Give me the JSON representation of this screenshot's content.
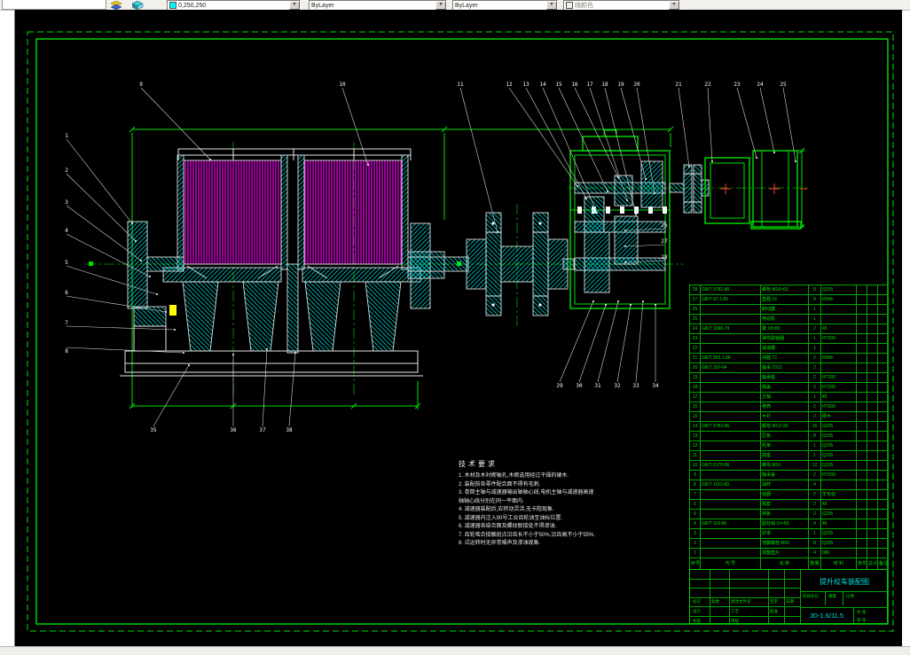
{
  "toolbar": {
    "color_value": "0,250,250",
    "linetype_value": "ByLayer",
    "lineweight_value": "ByLayer",
    "plotstyle_value": "随颜色",
    "swatch_color": "#00fafa"
  },
  "tech": {
    "heading": "技术要求",
    "lines": [
      "1. 木材及木衬楔轴孔,木楔选用经过干燥的硬木.",
      "2. 装配前各零件配合面不得有毛刺.",
      "3. 卷筒主轴与减速器输出轴轴心线,电机主轴与减速器高速",
      "   轴轴心线分别在同一平面内.",
      "4. 减速器装配后,应转动灵活,无卡阻现象.",
      "5. 减速器内注入90号工业齿轮油至油标位置.",
      "6. 减速器各结合面及螺纹联接处不得渗油.",
      "7. 齿轮啮合接触斑点沿齿长不小于50%,沿齿高不小于55%.",
      "8. 试运转时无异常噪声及渗油现象."
    ]
  },
  "bom": {
    "headers": [
      "序号",
      "代  号",
      "名  称",
      "数量",
      "材  料",
      "单件",
      "总计",
      "备注"
    ],
    "rows": [
      [
        "28",
        "GB/T 5782-86",
        "螺栓 M16×60",
        "8",
        "Q235",
        "",
        "",
        ""
      ],
      [
        "27",
        "GB/T 97.1-85",
        "垫圈 16",
        "8",
        "65Mn",
        "",
        "",
        ""
      ],
      [
        "26",
        "",
        "制动器",
        "1",
        "",
        "",
        "",
        ""
      ],
      [
        "25",
        "",
        "电动机",
        "1",
        "",
        "",
        "",
        ""
      ],
      [
        "24",
        "GB/T 1096-79",
        "键 18×80",
        "2",
        "45",
        "",
        "",
        ""
      ],
      [
        "23",
        "",
        "弹性联轴器",
        "1",
        "HT200",
        "",
        "",
        ""
      ],
      [
        "22",
        "",
        "减速器",
        "1",
        "",
        "",
        "",
        ""
      ],
      [
        "21",
        "GB/T 893.1-86",
        "挡圈 72",
        "2",
        "65Mn",
        "",
        "",
        ""
      ],
      [
        "20",
        "GB/T 297-84",
        "轴承 7312",
        "2",
        "",
        "",
        "",
        ""
      ],
      [
        "19",
        "",
        "轴承座",
        "2",
        "HT200",
        "",
        "",
        ""
      ],
      [
        "18",
        "",
        "端盖",
        "2",
        "HT200",
        "",
        "",
        ""
      ],
      [
        "17",
        "",
        "主轴",
        "1",
        "45",
        "",
        "",
        ""
      ],
      [
        "16",
        "",
        "卷筒",
        "2",
        "HT200",
        "",
        "",
        ""
      ],
      [
        "15",
        "",
        "木衬",
        "2",
        "硬木",
        "",
        "",
        ""
      ],
      [
        "14",
        "GB/T 5783-86",
        "螺栓 M12×35",
        "16",
        "Q235",
        "",
        "",
        ""
      ],
      [
        "13",
        "",
        "压板",
        "8",
        "Q235",
        "",
        "",
        ""
      ],
      [
        "12",
        "",
        "机架",
        "1",
        "Q235",
        "",
        "",
        ""
      ],
      [
        "11",
        "",
        "底座",
        "1",
        "Q235",
        "",
        "",
        ""
      ],
      [
        "10",
        "GB/T 6170-86",
        "螺母 M16",
        "12",
        "Q235",
        "",
        "",
        ""
      ],
      [
        "9",
        "",
        "轴承盖",
        "2",
        "HT200",
        "",
        "",
        ""
      ],
      [
        "8",
        "GB/T 1152-89",
        "油杯",
        "4",
        "",
        "",
        "",
        ""
      ],
      [
        "7",
        "",
        "毡圈",
        "2",
        "羊毛毡",
        "",
        "",
        ""
      ],
      [
        "6",
        "",
        "隔套",
        "2",
        "45",
        "",
        "",
        ""
      ],
      [
        "5",
        "",
        "挡板",
        "2",
        "Q235",
        "",
        "",
        ""
      ],
      [
        "4",
        "GB/T 119-86",
        "圆柱销 10×50",
        "4",
        "45",
        "",
        "",
        ""
      ],
      [
        "3",
        "",
        "护罩",
        "1",
        "Q235",
        "",
        "",
        ""
      ],
      [
        "2",
        "",
        "地脚螺栓 M20",
        "8",
        "Q235",
        "",
        "",
        ""
      ],
      [
        "1",
        "",
        "调整垫片",
        "4",
        "08F",
        "",
        "",
        ""
      ]
    ]
  },
  "titleblock": {
    "title": "提升绞车装配图",
    "code": "JD-1.6/11.5",
    "labels": {
      "mark": "标记",
      "count": "处数",
      "doc": "更改文件号",
      "sign": "签字",
      "date": "日期",
      "design": "设计",
      "check": "校核",
      "process": "工艺",
      "review": "审核",
      "approve": "批准",
      "stage": "阶段标记",
      "weight": "重量",
      "scale": "比例",
      "sheets": "共 张",
      "sheet": "第 张"
    }
  },
  "drawing": {
    "balloons": [
      [
        1,
        74,
        155,
        148,
        252
      ],
      [
        2,
        74,
        194,
        152,
        272
      ],
      [
        3,
        74,
        230,
        158,
        294
      ],
      [
        4,
        74,
        262,
        168,
        312
      ],
      [
        5,
        74,
        298,
        176,
        332
      ],
      [
        6,
        74,
        332,
        186,
        352
      ],
      [
        7,
        74,
        366,
        196,
        372
      ],
      [
        8,
        74,
        398,
        206,
        398
      ],
      [
        9,
        158,
        97,
        236,
        180
      ],
      [
        10,
        385,
        97,
        414,
        186
      ],
      [
        11,
        518,
        97,
        560,
        262
      ],
      [
        12,
        573,
        97,
        650,
        210
      ],
      [
        13,
        592,
        97,
        660,
        224
      ],
      [
        14,
        611,
        97,
        672,
        240
      ],
      [
        15,
        629,
        97,
        684,
        216
      ],
      [
        16,
        647,
        97,
        696,
        200
      ],
      [
        17,
        664,
        97,
        706,
        226
      ],
      [
        18,
        681,
        97,
        716,
        242
      ],
      [
        19,
        699,
        97,
        727,
        202
      ],
      [
        20,
        717,
        97,
        737,
        218
      ],
      [
        21,
        764,
        97,
        776,
        188
      ],
      [
        22,
        797,
        97,
        802,
        182
      ],
      [
        23,
        830,
        97,
        852,
        178
      ],
      [
        24,
        856,
        97,
        872,
        172
      ],
      [
        25,
        882,
        97,
        896,
        182
      ],
      [
        26,
        748,
        256,
        704,
        260
      ],
      [
        27,
        748,
        274,
        704,
        278
      ],
      [
        28,
        748,
        292,
        704,
        296
      ],
      [
        29,
        630,
        437,
        668,
        340
      ],
      [
        30,
        652,
        437,
        682,
        344
      ],
      [
        31,
        673,
        437,
        696,
        340
      ],
      [
        32,
        695,
        437,
        710,
        344
      ],
      [
        33,
        716,
        437,
        724,
        340
      ],
      [
        34,
        738,
        437,
        738,
        344
      ],
      [
        35,
        172,
        487,
        212,
        412
      ],
      [
        36,
        262,
        487,
        262,
        400
      ],
      [
        37,
        295,
        487,
        300,
        394
      ],
      [
        38,
        325,
        487,
        332,
        398
      ]
    ]
  }
}
